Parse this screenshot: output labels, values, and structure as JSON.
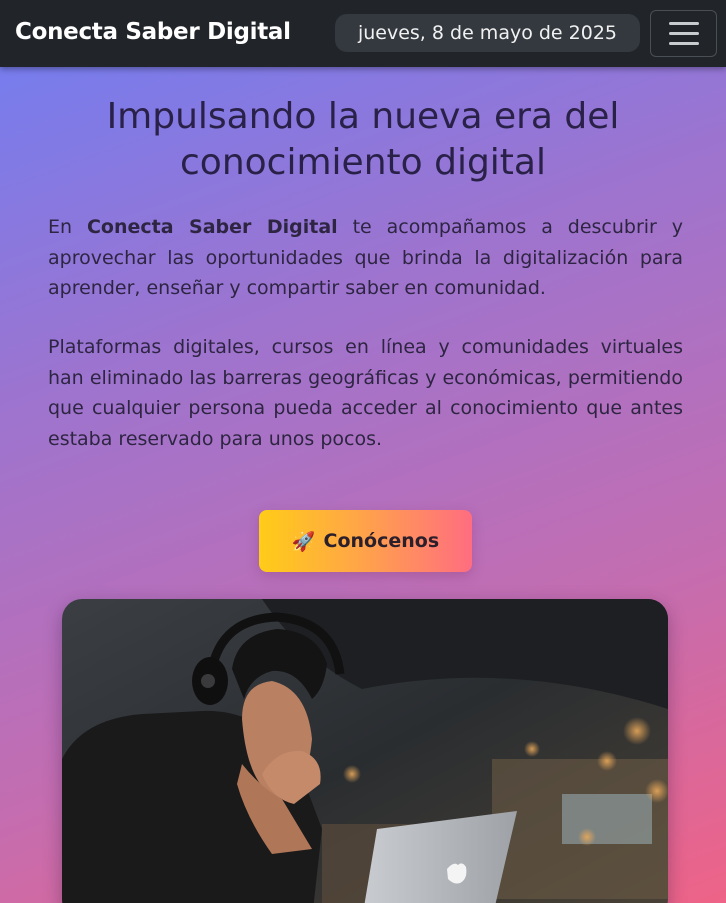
{
  "navbar": {
    "brand": "Conecta Saber Digital",
    "date": "jueves, 8 de mayo de 2025",
    "menu_icon": "hamburger-menu-icon"
  },
  "hero": {
    "title": "Impulsando la nueva era del conocimiento digital",
    "p1_prefix": "En ",
    "p1_brand": "Conecta Saber Digital",
    "p1_rest": " te acompañamos a descubrir y aprovechar las oportunidades que brinda la digitalización para aprender, enseñar y compartir saber en comunidad.",
    "p2": "Plataformas digitales, cursos en línea y comunidades virtuales han eliminado las barreras geográficas y económicas, permitiendo que cualquier persona pueda acceder al conocimiento que antes estaba reservado para unos pocos.",
    "cta_icon": "🚀",
    "cta_label": "Conócenos"
  },
  "image": {
    "subject": "person-with-headphones-laptop-image"
  }
}
